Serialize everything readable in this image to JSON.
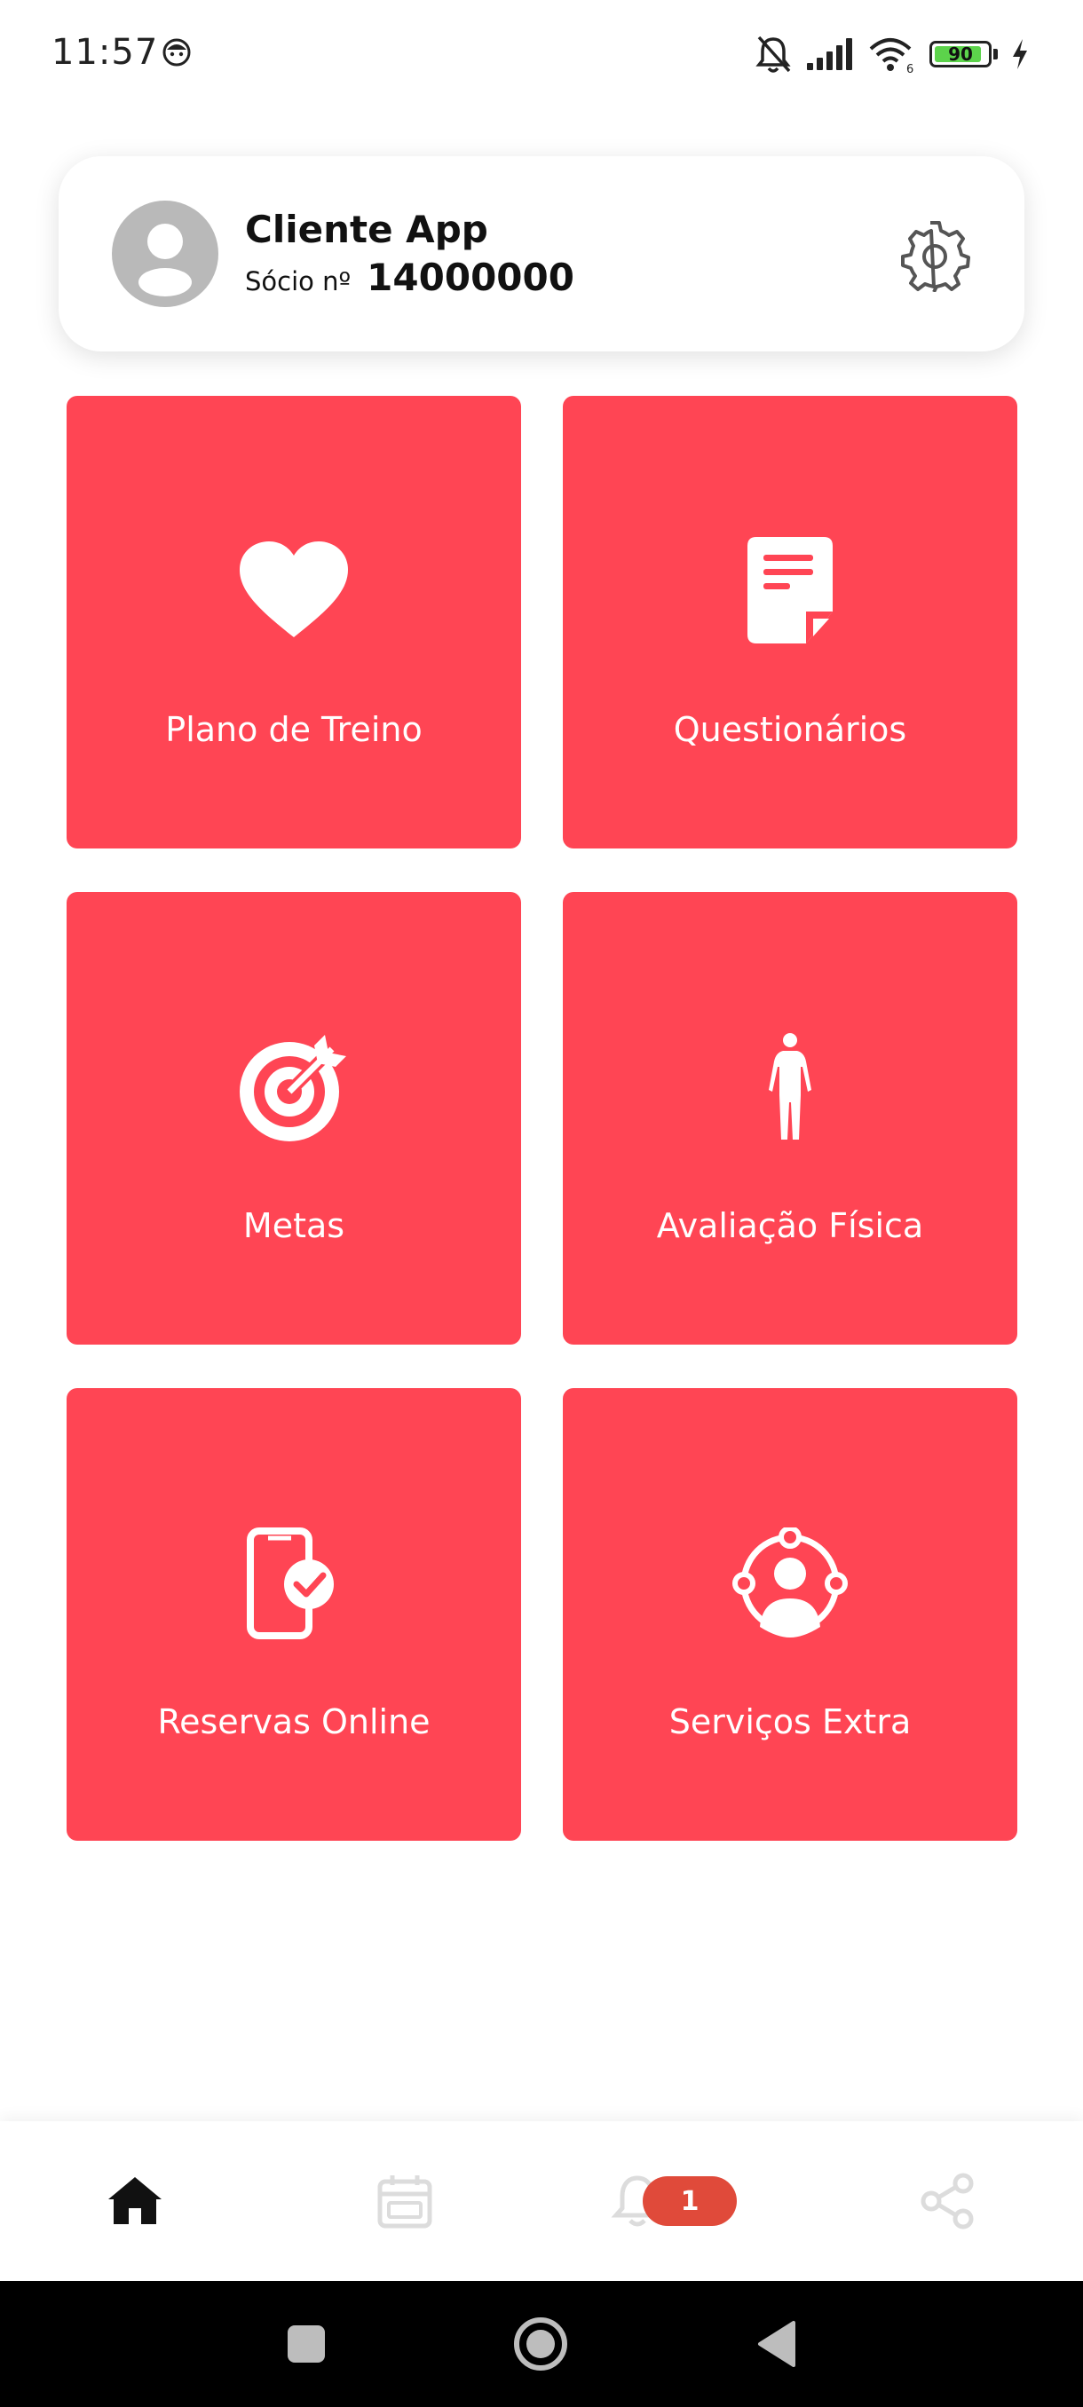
{
  "status_bar": {
    "time": "11:57",
    "battery_level": "90",
    "battery_fraction": 0.9,
    "icons": [
      "face-icon",
      "bell-muted-icon",
      "signal-icon",
      "wifi-icon",
      "battery-icon",
      "charging-icon"
    ]
  },
  "profile": {
    "name": "Cliente App",
    "member_label": "Sócio nº",
    "member_number": "14000000",
    "icons": [
      "avatar-icon",
      "gear-icon"
    ]
  },
  "tiles": [
    {
      "label": "Plano de Treino",
      "icon": "heart-icon"
    },
    {
      "label": "Questionários",
      "icon": "document-icon"
    },
    {
      "label": "Metas",
      "icon": "target-icon"
    },
    {
      "label": "Avaliação Física",
      "icon": "human-body-icon"
    },
    {
      "label": "Reservas Online",
      "icon": "phone-check-icon"
    },
    {
      "label": "Serviços Extra",
      "icon": "user-network-icon"
    }
  ],
  "bottom_nav": {
    "items": [
      "home-icon",
      "calendar-icon",
      "bell-icon",
      "share-icon"
    ],
    "active": "home-icon",
    "notifications_badge": "1"
  },
  "colors": {
    "tile": "#ff4554",
    "badge": "#e04a3a",
    "avatar": "#b9b9b9",
    "nav_inactive": "#dcdcdc",
    "nav_active": "#111111",
    "battery_fill": "#5cd34b"
  }
}
